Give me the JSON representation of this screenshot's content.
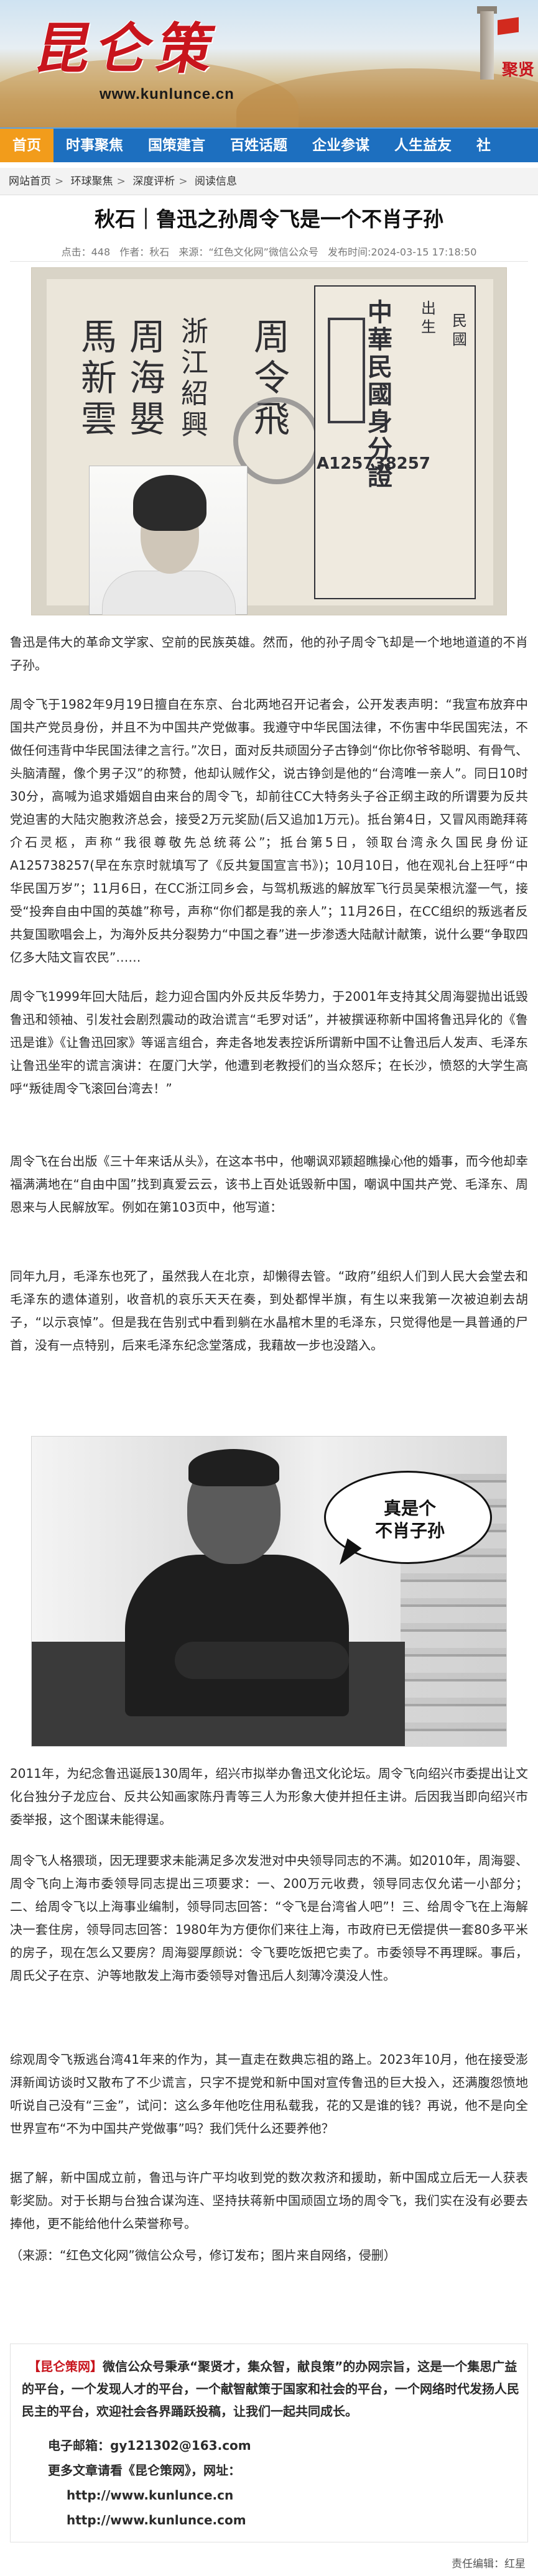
{
  "site": {
    "logo_text": "昆仑策",
    "url_text": "www.kunlunce.cn",
    "corner_text": "聚贤"
  },
  "nav": [
    "首页",
    "时事聚焦",
    "国策建言",
    "百姓话题",
    "企业参谋",
    "人生益友",
    "社"
  ],
  "breadcrumb": [
    "网站首页",
    "环球聚焦",
    "深度评析",
    "阅读信息"
  ],
  "article": {
    "title": "秋石｜鲁迅之孙周令飞是一个不肖子孙",
    "meta": {
      "clicks": "点击：448",
      "author": "作者：秋石",
      "source": "来源：“红色文化网”微信公众号",
      "published": "发布时间:2024-03-15 17:18:50"
    },
    "id_card": {
      "name_col": "周令飛",
      "father_col": "周海嬰",
      "mother_col": "馬新雲",
      "province_col": "浙江紹興",
      "header": "中華民國身分證",
      "id_number": "A125738257",
      "misc_col1": "出生",
      "misc_col2": "民國"
    },
    "paragraphs": [
      "鲁迅是伟大的革命文学家、空前的民族英雄。然而，他的孙子周令飞却是一个地地道道的不肖子孙。",
      "周令飞于1982年9月19日擅自在东京、台北两地召开记者会，公开发表声明：“我宣布放弃中国共产党员身份，并且不为中国共产党做事。我遵守中华民国法律，不伤害中华民国宪法，不做任何违背中华民国法律之言行。”次日，面对反共顽固分子古铮剑“你比你爷爷聪明、有骨气、头脑清醒，像个男子汉”的称赞，他却认贼作父，说古铮剑是他的“台湾唯一亲人”。同日10时30分，高喊为追求婚姻自由来台的周令飞，却前往CC大特务头子谷正纲主政的所谓要为反共党迫害的大陆灾胞救济总会，接受2万元奖励(后又追加1万元)。抵台第4日，又冒风雨跪拜蒋介石灵柩，声称“我很尊敬先总统蒋公”；抵台第5日，领取台湾永久国民身份证A125738257(早在东京时就填写了《反共复国宣言书》)；10月10日，他在观礼台上狂呼“中华民国万岁”；11月6日，在CC浙江同乡会，与驾机叛逃的解放军飞行员吴荣根沆瀣一气，接受“投奔自由中国的英雄”称号，声称“你们都是我的亲人”；11月26日，在CC组织的叛逃者反共复国歌唱会上，为海外反共分裂势力“中国之春”进一步渗透大陆献计献策，说什么要“争取四亿多大陆文盲农民”……",
      "周令飞1999年回大陆后，趁力迎合国内外反共反华势力，于2001年支持其父周海婴抛出诋毁鲁迅和领袖、引发社会剧烈震动的政治谎言“毛罗对话”，并被撰诬称新中国将鲁迅异化的《鲁迅是谁》《让鲁迅回家》等谣言组合，奔走各地发表控诉所谓新中国不让鲁迅后人发声、毛泽东让鲁迅坐牢的谎言演讲：在厦门大学，他遭到老教授们的当众怒斥；在长沙，愤怒的大学生高呼“叛徒周令飞滚回台湾去！”",
      "周令飞在台出版《三十年来话从头》，在这本书中，他嘲讽邓颖超瞧操心他的婚事，而今他却幸福满满地在“自由中国”找到真爱云云，该书上百处诋毁新中国，嘲讽中国共产党、毛泽东、周恩来与人民解放军。例如在第103页中，他写道：",
      "同年九月，毛泽东也死了，虽然我人在北京，却懒得去管。“政府”组织人们到人民大会堂去和毛泽东的遗体道别，收音机的哀乐天天在奏，到处都悍半旗，有生以来我第一次被迫剃去胡子，“以示哀悼”。但是我在告别式中看到躺在水晶棺木里的毛泽东，只觉得他是一具普通的尸首，没有一点特别，后来毛泽东纪念堂落成，我藉故一步也没踏入。",
      "2011年，为纪念鲁迅诞辰130周年，绍兴市拟举办鲁迅文化论坛。周令飞向绍兴市委提出让文化台独分子龙应台、反共公知画家陈丹青等三人为形象大使并担任主讲。后因我当即向绍兴市委举报，这个图谋未能得逞。",
      "周令飞人格猥琐，因无理要求未能满足多次发泄对中央领导同志的不满。如2010年，周海婴、周令飞向上海市委领导同志提出三项要求：一、200万元收费，领导同志仅允诺一小部分；二、给周令飞以上海事业编制，领导同志回答：“令飞是台湾省人吧”！三、给周令飞在上海解决一套住房，领导同志回答：1980年为方便你们来往上海，市政府已无偿提供一套80多平米的房子，现在怎么又要房？周海婴厚颜说：令飞要吃饭把它卖了。市委领导不再理睬。事后，周氏父子在京、沪等地散发上海市委领导对鲁迅后人刻薄冷漠没人性。",
      "综观周令飞叛逃台湾41年来的作为，其一直走在数典忘祖的路上。2023年10月，他在接受澎湃新闻访谈时又散布了不少谎言，只字不提党和新中国对宣传鲁迅的巨大投入，还满腹怨愤地听说自己没有“三金”，试问：这么多年他吃住用私载我，花的又是谁的钱？再说，他不是向全世界宣布“不为中国共产党做事”吗？我们凭什么还要养他？",
      "据了解，新中国成立前，鲁迅与许广平均收到党的数次救济和援助，新中国成立后无一人获表彰奖励。对于长期与台独合谋沟连、坚持扶蒋新中国顽固立场的周令飞，我们实在没有必要去捧他，更不能给他什么荣誉称号。",
      "（来源：“红色文化网”微信公众号，修订发布；图片来自网络，侵删）"
    ],
    "bubble_text": "真是个\n不肖子孙"
  },
  "footer": {
    "intro_a": "【昆仑策网】",
    "intro_b": "微信公众号秉承“聚贤才，集众智，献良策”的办网宗旨，这是一个集思广益的平台，一个发现人才的平台，一个献智献策于国家和社会的平台，一个网络时代发扬人民民主的平台，欢迎社会各界踊跃投稿，让我们一起共同成长。",
    "email": "电子邮箱：gy121302@163.com",
    "more": "更多文章请看《昆仑策网》，网址：",
    "url1": "http://www.kunlunce.cn",
    "url2": "http://www.kunlunce.com",
    "editor": "责任编辑：红星"
  }
}
